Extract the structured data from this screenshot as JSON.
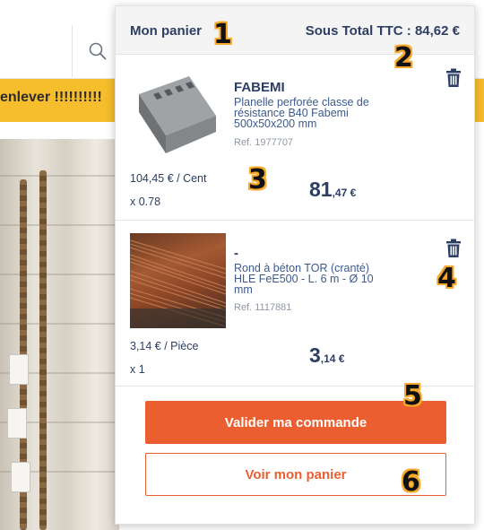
{
  "background": {
    "banner_text": "enlever !!!!!!!!!!"
  },
  "cart": {
    "title": "Mon panier",
    "subtotal": "Sous Total TTC : 84,62 €",
    "items": [
      {
        "brand": "FABEMI",
        "description": "Planelle perforée classe de résistance B40 Fabemi 500x50x200 mm",
        "ref": "Ref. 1977707",
        "unit_price": "104,45 € / Cent",
        "quantity": "x 0.78",
        "price_int": "81",
        "price_dec": ",47 €",
        "image": "concrete-block-image"
      },
      {
        "brand": "-",
        "description": "Rond à béton TOR (cranté) HLE FeE500 - L. 6 m - Ø 10 mm",
        "ref": "Ref. 1117881",
        "unit_price": "3,14 € / Pièce",
        "quantity": "x 1",
        "price_int": "3",
        "price_dec": ",14 €",
        "image": "rebar-image"
      }
    ],
    "buttons": {
      "validate": "Valider ma commande",
      "view_cart": "Voir mon panier"
    }
  },
  "annotations": [
    "1",
    "2",
    "3",
    "4",
    "5",
    "6"
  ],
  "colors": {
    "accent": "#eb5e2f",
    "banner": "#f6bd2c",
    "text": "#2c3e63",
    "link_text": "#3d5a8c",
    "annotation": "#f6a92a"
  },
  "icons": [
    "search-icon",
    "trash-icon"
  ]
}
